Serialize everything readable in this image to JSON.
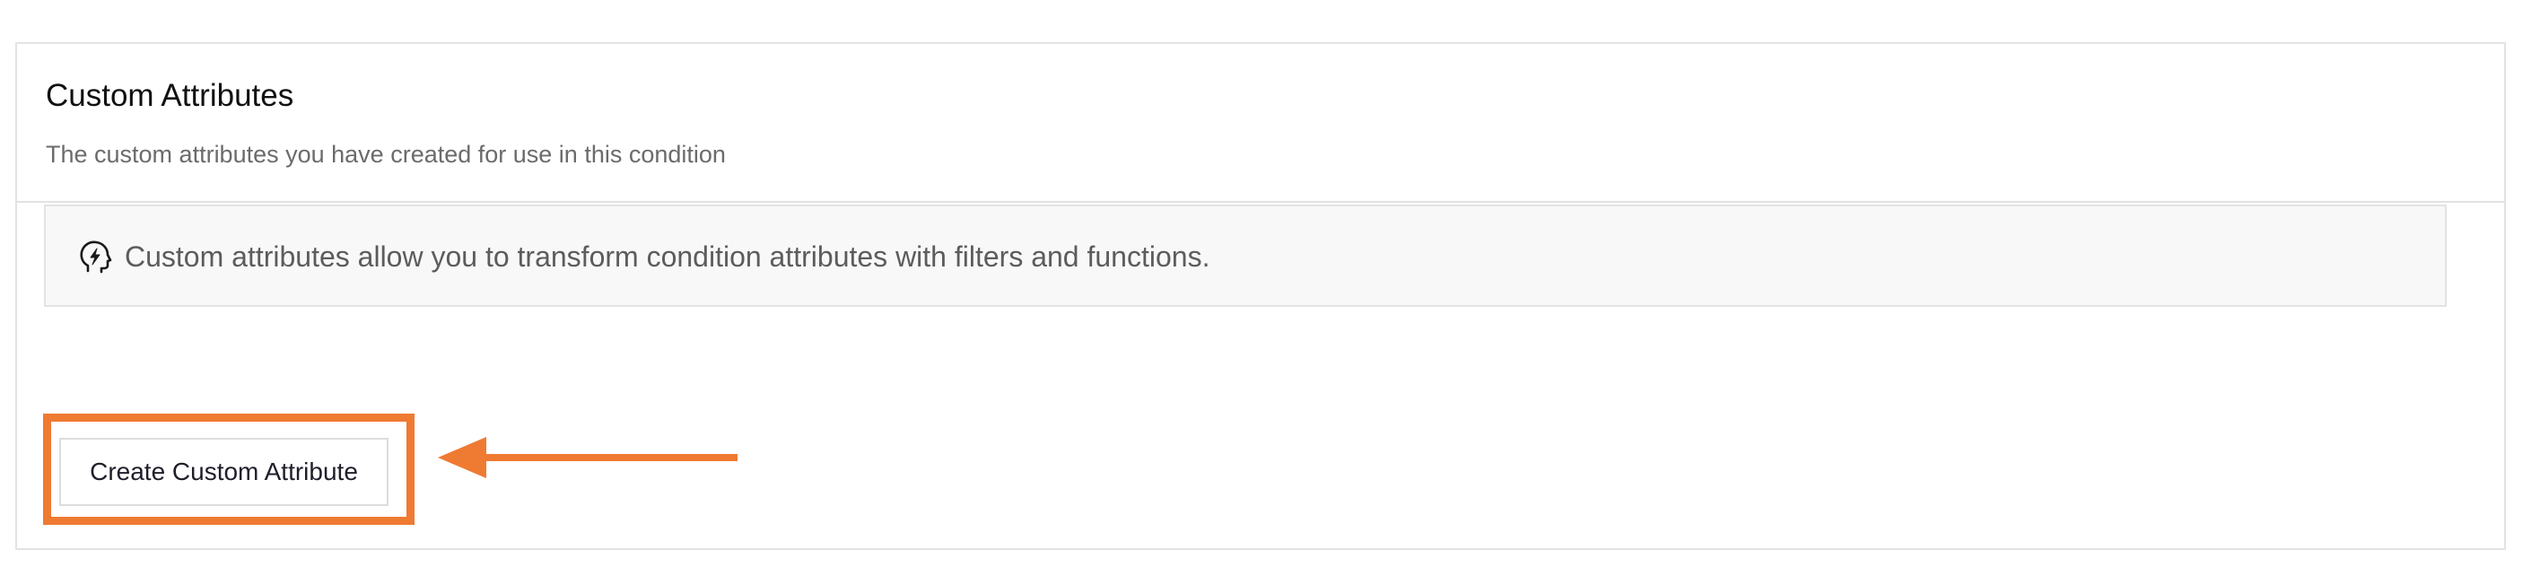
{
  "section": {
    "title": "Custom Attributes",
    "subtitle": "The custom attributes you have created for use in this condition"
  },
  "info": {
    "icon": "head-lightning-icon",
    "text": "Custom attributes allow you to transform condition attributes with filters and functions."
  },
  "actions": {
    "create_button_label": "Create Custom Attribute"
  },
  "annotation": {
    "highlight_color": "#ef7a32",
    "arrow_color": "#ef7a32"
  },
  "colors": {
    "border": "#e3e3e3",
    "info_background": "#f8f8f8",
    "subtitle_text": "#6b6b6b",
    "info_text": "#5c5c5c"
  }
}
